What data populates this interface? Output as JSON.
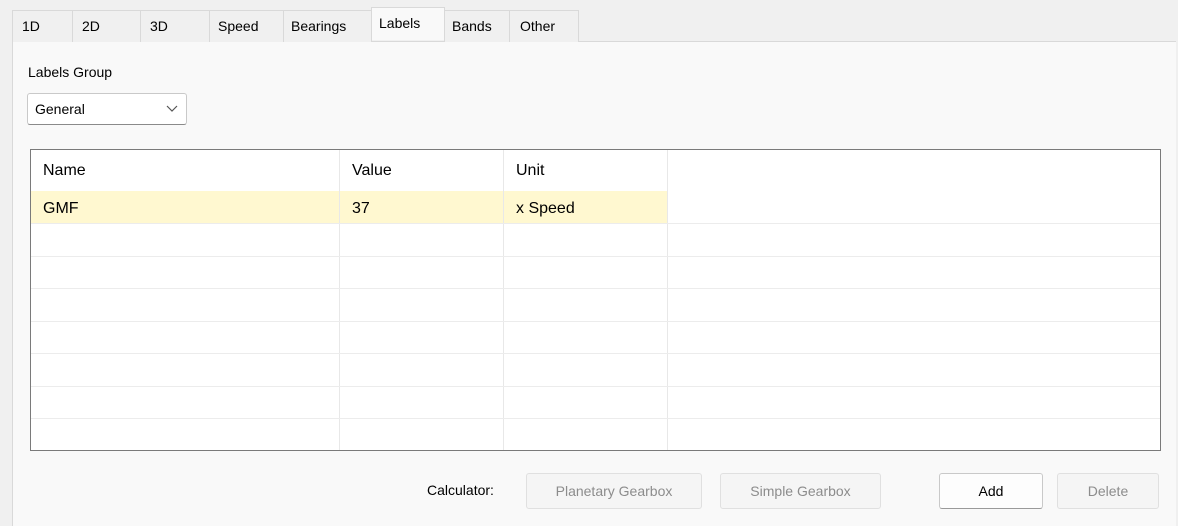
{
  "tabs": [
    {
      "label": "1D",
      "active": false
    },
    {
      "label": "2D",
      "active": false
    },
    {
      "label": "3D",
      "active": false
    },
    {
      "label": "Speed",
      "active": false
    },
    {
      "label": "Bearings",
      "active": false
    },
    {
      "label": "Labels",
      "active": true
    },
    {
      "label": "Bands",
      "active": false
    },
    {
      "label": "Other",
      "active": false
    }
  ],
  "labels_group": {
    "label": "Labels Group",
    "selected": "General",
    "icon": "chevron-down-icon"
  },
  "table": {
    "columns": [
      "Name",
      "Value",
      "Unit"
    ],
    "rows": [
      {
        "name": "GMF",
        "value": "37",
        "unit": "x Speed",
        "highlighted": true
      }
    ],
    "highlight_color": "#fff8d0"
  },
  "calculator": {
    "label": "Calculator:",
    "planetary_label": "Planetary Gearbox",
    "simple_label": "Simple Gearbox"
  },
  "actions": {
    "add_label": "Add",
    "delete_label": "Delete"
  }
}
